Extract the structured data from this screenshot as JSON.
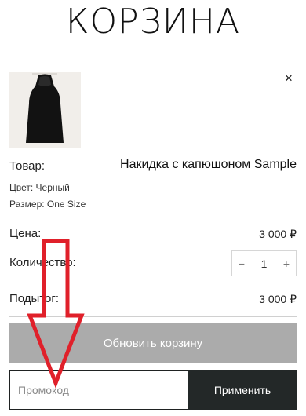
{
  "page": {
    "title": "КОРЗИНА"
  },
  "cart_item": {
    "remove_icon": "×",
    "product_label": "Товар:",
    "product_name": "Накидка с капюшоном Sample",
    "color": "Цвет: Черный",
    "size": "Размер: One Size",
    "price_label": "Цена:",
    "price": "3 000 ₽",
    "quantity_label": "Количество:",
    "quantity": "1",
    "decrease": "−",
    "increase": "+",
    "subtotal_label": "Подытог:",
    "subtotal": "3 000 ₽"
  },
  "actions": {
    "update_cart": "Обновить корзину",
    "promo_placeholder": "Промокод",
    "apply": "Применить"
  },
  "colors": {
    "update_button": "#ababab",
    "apply_button": "#232828",
    "annotation_arrow": "#e0202a"
  }
}
